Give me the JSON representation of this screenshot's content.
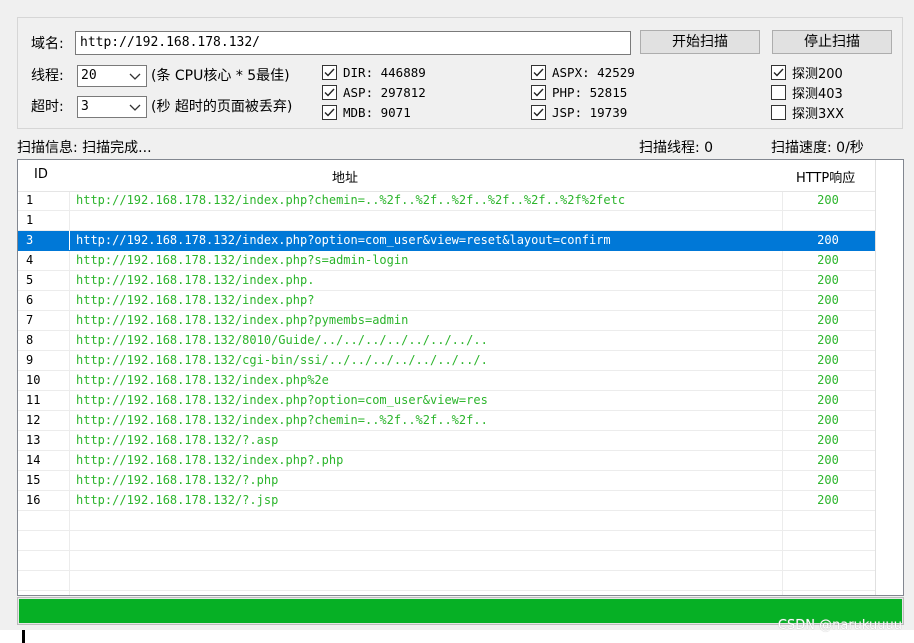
{
  "form": {
    "domain_label": "域名:",
    "domain_value": "http://192.168.178.132/",
    "start_button": "开始扫描",
    "stop_button": "停止扫描",
    "threads_label": "线程:",
    "threads_value": "20",
    "threads_hint": "(条 CPU核心 * 5最佳)",
    "timeout_label": "超时:",
    "timeout_value": "3",
    "timeout_hint": "(秒 超时的页面被丢弃)"
  },
  "dict_options": [
    {
      "label": "DIR: 446889",
      "checked": true
    },
    {
      "label": "ASP: 297812",
      "checked": true
    },
    {
      "label": "MDB: 9071",
      "checked": true
    },
    {
      "label": "ASPX: 42529",
      "checked": true
    },
    {
      "label": "PHP: 52815",
      "checked": true
    },
    {
      "label": "JSP: 19739",
      "checked": true
    }
  ],
  "probe_options": [
    {
      "label": "探测200",
      "checked": true
    },
    {
      "label": "探测403",
      "checked": false
    },
    {
      "label": "探测3XX",
      "checked": false
    }
  ],
  "status": {
    "info": "扫描信息: 扫描完成...",
    "threads": "扫描线程: 0",
    "speed": "扫描速度: 0/秒"
  },
  "table": {
    "columns": [
      "ID",
      "地址",
      "HTTP响应"
    ],
    "selected_index": 2,
    "rows": [
      {
        "id": "1",
        "url": "http://192.168.178.132/index.php?chemin=..%2f..%2f..%2f..%2f..%2f..%2f%2fetc",
        "code": "200"
      },
      {
        "id": "1",
        "url": "",
        "code": ""
      },
      {
        "id": "3",
        "url": "http://192.168.178.132/index.php?option=com_user&view=reset&layout=confirm",
        "code": "200"
      },
      {
        "id": "4",
        "url": "http://192.168.178.132/index.php?s=admin-login",
        "code": "200"
      },
      {
        "id": "5",
        "url": "http://192.168.178.132/index.php.",
        "code": "200"
      },
      {
        "id": "6",
        "url": "http://192.168.178.132/index.php?",
        "code": "200"
      },
      {
        "id": "7",
        "url": "http://192.168.178.132/index.php?pymembs=admin",
        "code": "200"
      },
      {
        "id": "8",
        "url": "http://192.168.178.132/8010/Guide/../../../../../../../..",
        "code": "200"
      },
      {
        "id": "9",
        "url": "http://192.168.178.132/cgi-bin/ssi/../../../../../../../.",
        "code": "200"
      },
      {
        "id": "10",
        "url": "http://192.168.178.132/index.php%2e",
        "code": "200"
      },
      {
        "id": "11",
        "url": "http://192.168.178.132/index.php?option=com_user&view=res",
        "code": "200"
      },
      {
        "id": "12",
        "url": "http://192.168.178.132/index.php?chemin=..%2f..%2f..%2f..",
        "code": "200"
      },
      {
        "id": "13",
        "url": "http://192.168.178.132/?.asp",
        "code": "200"
      },
      {
        "id": "14",
        "url": "http://192.168.178.132/index.php?.php",
        "code": "200"
      },
      {
        "id": "15",
        "url": "http://192.168.178.132/?.php",
        "code": "200"
      },
      {
        "id": "16",
        "url": "http://192.168.178.132/?.jsp",
        "code": "200"
      }
    ],
    "empty_rows": 4
  },
  "progress": {
    "percent": 100,
    "color": "#06b025"
  },
  "watermark": "CSDN @narukuuuu"
}
